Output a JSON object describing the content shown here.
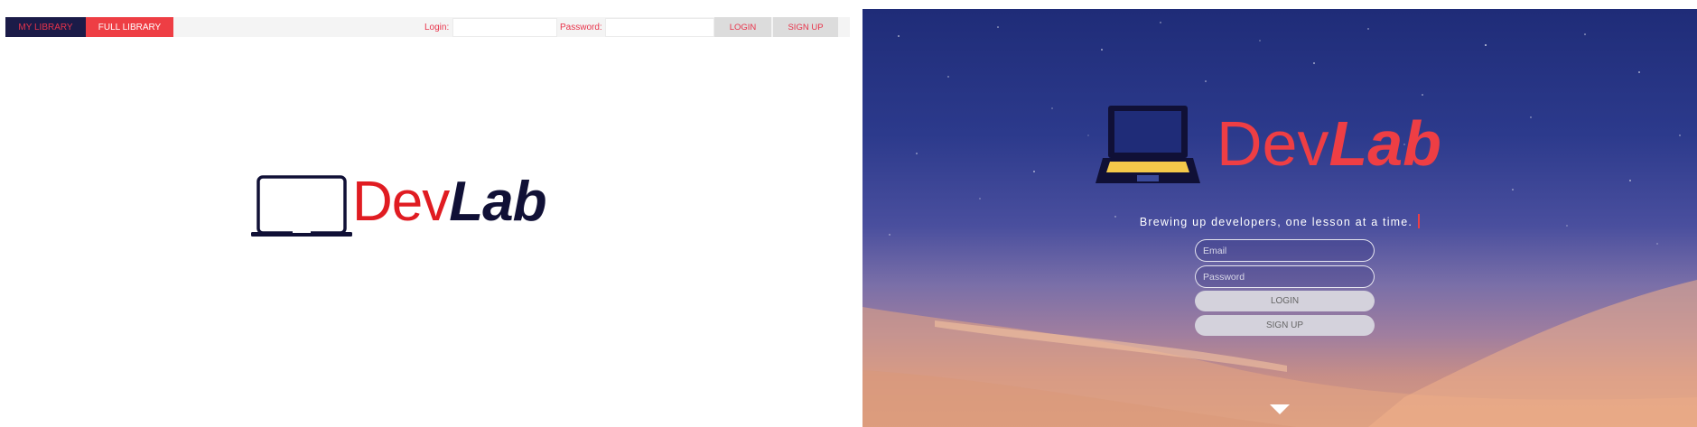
{
  "left": {
    "tabs": {
      "my_library": "MY LIBRARY",
      "full_library": "FULL LIBRARY"
    },
    "login_label": "Login:",
    "password_label": "Password:",
    "login_button": "LOGIN",
    "signup_button": "SIGN UP",
    "logo": {
      "dev": "Dev",
      "lab": "Lab"
    }
  },
  "right": {
    "logo": {
      "dev": "Dev",
      "lab": "Lab"
    },
    "tagline": "Brewing up developers, one lesson at a time.",
    "email_placeholder": "Email",
    "password_placeholder": "Password",
    "login_button": "LOGIN",
    "signup_button": "SIGN UP"
  },
  "colors": {
    "accent_red": "#ee3e44",
    "navy": "#1b1b48"
  }
}
